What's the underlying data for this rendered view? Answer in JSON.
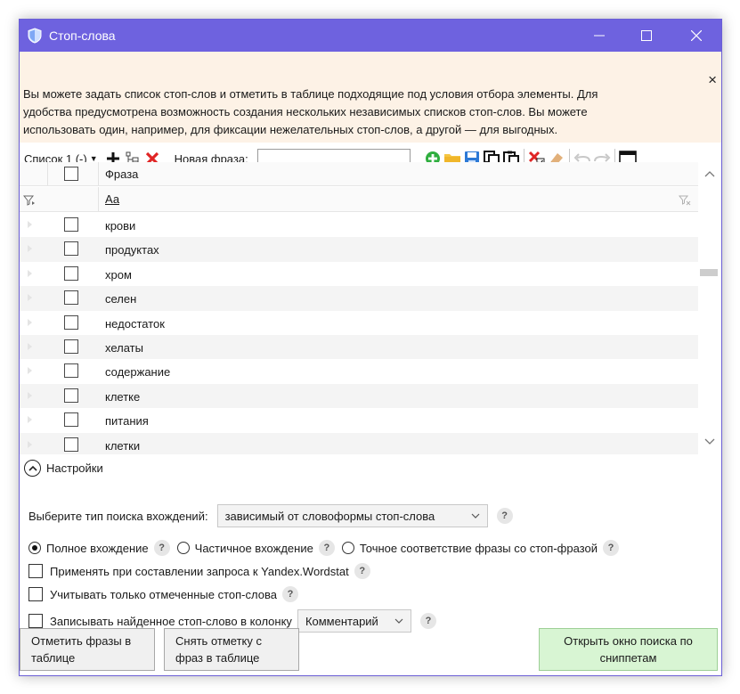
{
  "window": {
    "title": "Стоп-слова",
    "controls": {
      "minimize": "—",
      "maximize": "☐",
      "close": "✕"
    }
  },
  "info": {
    "line1": "Вы можете задать список стоп-слов и отметить в таблице подходящие под условия отбора элементы. Для",
    "line2": "удобства предусмотрена возможность создания нескольких независимых списков стоп-слов. Вы можете",
    "line3": "использовать один, например, для фиксации нежелательных стоп-слов, а другой — для выгодных.",
    "close": "×"
  },
  "toolbar": {
    "list_select": "Список 1 (-)",
    "new_phrase_label": "Новая фраза:",
    "new_phrase_value": "",
    "icons": [
      "plus-icon",
      "tree-icon",
      "delete-icon",
      "add-green-icon",
      "folder-icon",
      "save-icon",
      "copy-icon",
      "paste-icon",
      "clear-marked-icon",
      "eraser-icon",
      "undo-icon",
      "redo-icon",
      "window-icon"
    ]
  },
  "grid": {
    "column_header": "Фраза",
    "filter_text": "Аа",
    "rows": [
      "крови",
      "продуктах",
      "хром",
      "селен",
      "недостаток",
      "хелаты",
      "содержание",
      "клетке",
      "питания",
      "клетки"
    ]
  },
  "settings": {
    "toggle_label": "Настройки",
    "search_type_label": "Выберите тип поиска вхождений:",
    "search_type_value": "зависимый от словоформы стоп-слова",
    "radio_full": "Полное вхождение",
    "radio_partial": "Частичное вхождение",
    "radio_exact": "Точное соответствие фразы со стоп-фразой",
    "check_wordstat": "Применять при составлении запроса к Yandex.Wordstat",
    "check_only_marked": "Учитывать только отмеченные стоп-слова",
    "check_write_column": "Записывать найденное стоп-слово в колонку",
    "column_select": "Комментарий",
    "help": "?"
  },
  "buttons": {
    "mark_line1": "Отметить фразы в",
    "mark_line2": "таблице",
    "unmark_line1": "Снять отметку с",
    "unmark_line2": "фраз в таблице",
    "snippets_line1": "Открыть окно поиска по",
    "snippets_line2": "сниппетам"
  },
  "colors": {
    "titlebar": "#6e62df",
    "info_bg": "#fdf2e6",
    "green_button": "#d8f5d3",
    "delete_red": "#e02424"
  }
}
